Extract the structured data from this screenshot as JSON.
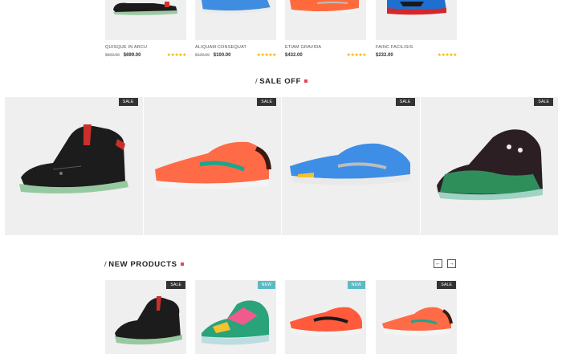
{
  "top_products": [
    {
      "name": "QUISQUE IN ARCU",
      "old_price": "$800.00",
      "price": "$699.00",
      "rating": 4,
      "shoe": "black-red-hightop"
    },
    {
      "name": "ALIQUAM CONSEQUAT",
      "old_price": "$120.00",
      "price": "$100.00",
      "rating": 4,
      "shoe": "blue-runner"
    },
    {
      "name": "ETIAM GRAVIDA",
      "old_price": "",
      "price": "$432.00",
      "rating": 4,
      "shoe": "orange-runner"
    },
    {
      "name": "FAINC FACILISIS",
      "old_price": "",
      "price": "$232.00",
      "rating": 4,
      "shoe": "blue-red-basketball"
    }
  ],
  "sale_section": {
    "title": "SALE OFF",
    "slash": "/",
    "tiles": [
      {
        "badge": "SALE",
        "shoe": "black-red-hightop"
      },
      {
        "badge": "SALE",
        "shoe": "orange-flyknit"
      },
      {
        "badge": "SALE",
        "shoe": "blue-flyknit"
      },
      {
        "badge": "SALE",
        "shoe": "green-black-basketball"
      }
    ]
  },
  "new_section": {
    "title": "NEW PRODUCTS",
    "slash": "/",
    "prev_icon": "←",
    "next_icon": "→",
    "cards": [
      {
        "badge": "SALE",
        "badge_type": "sale",
        "shoe": "black-red-hightop"
      },
      {
        "badge": "NEW",
        "badge_type": "new",
        "shoe": "multicolor-lebron"
      },
      {
        "badge": "NEW",
        "badge_type": "new",
        "shoe": "orange-black-runner"
      },
      {
        "badge": "SALE",
        "badge_type": "sale",
        "shoe": "orange-flyknit"
      }
    ]
  },
  "colors": {
    "accent": "#e8435a",
    "new_badge": "#5bbac6",
    "sale_badge": "#333333",
    "tile_bg": "#efefef",
    "star": "#f5b301"
  },
  "stars_glyph": "★★★★★"
}
